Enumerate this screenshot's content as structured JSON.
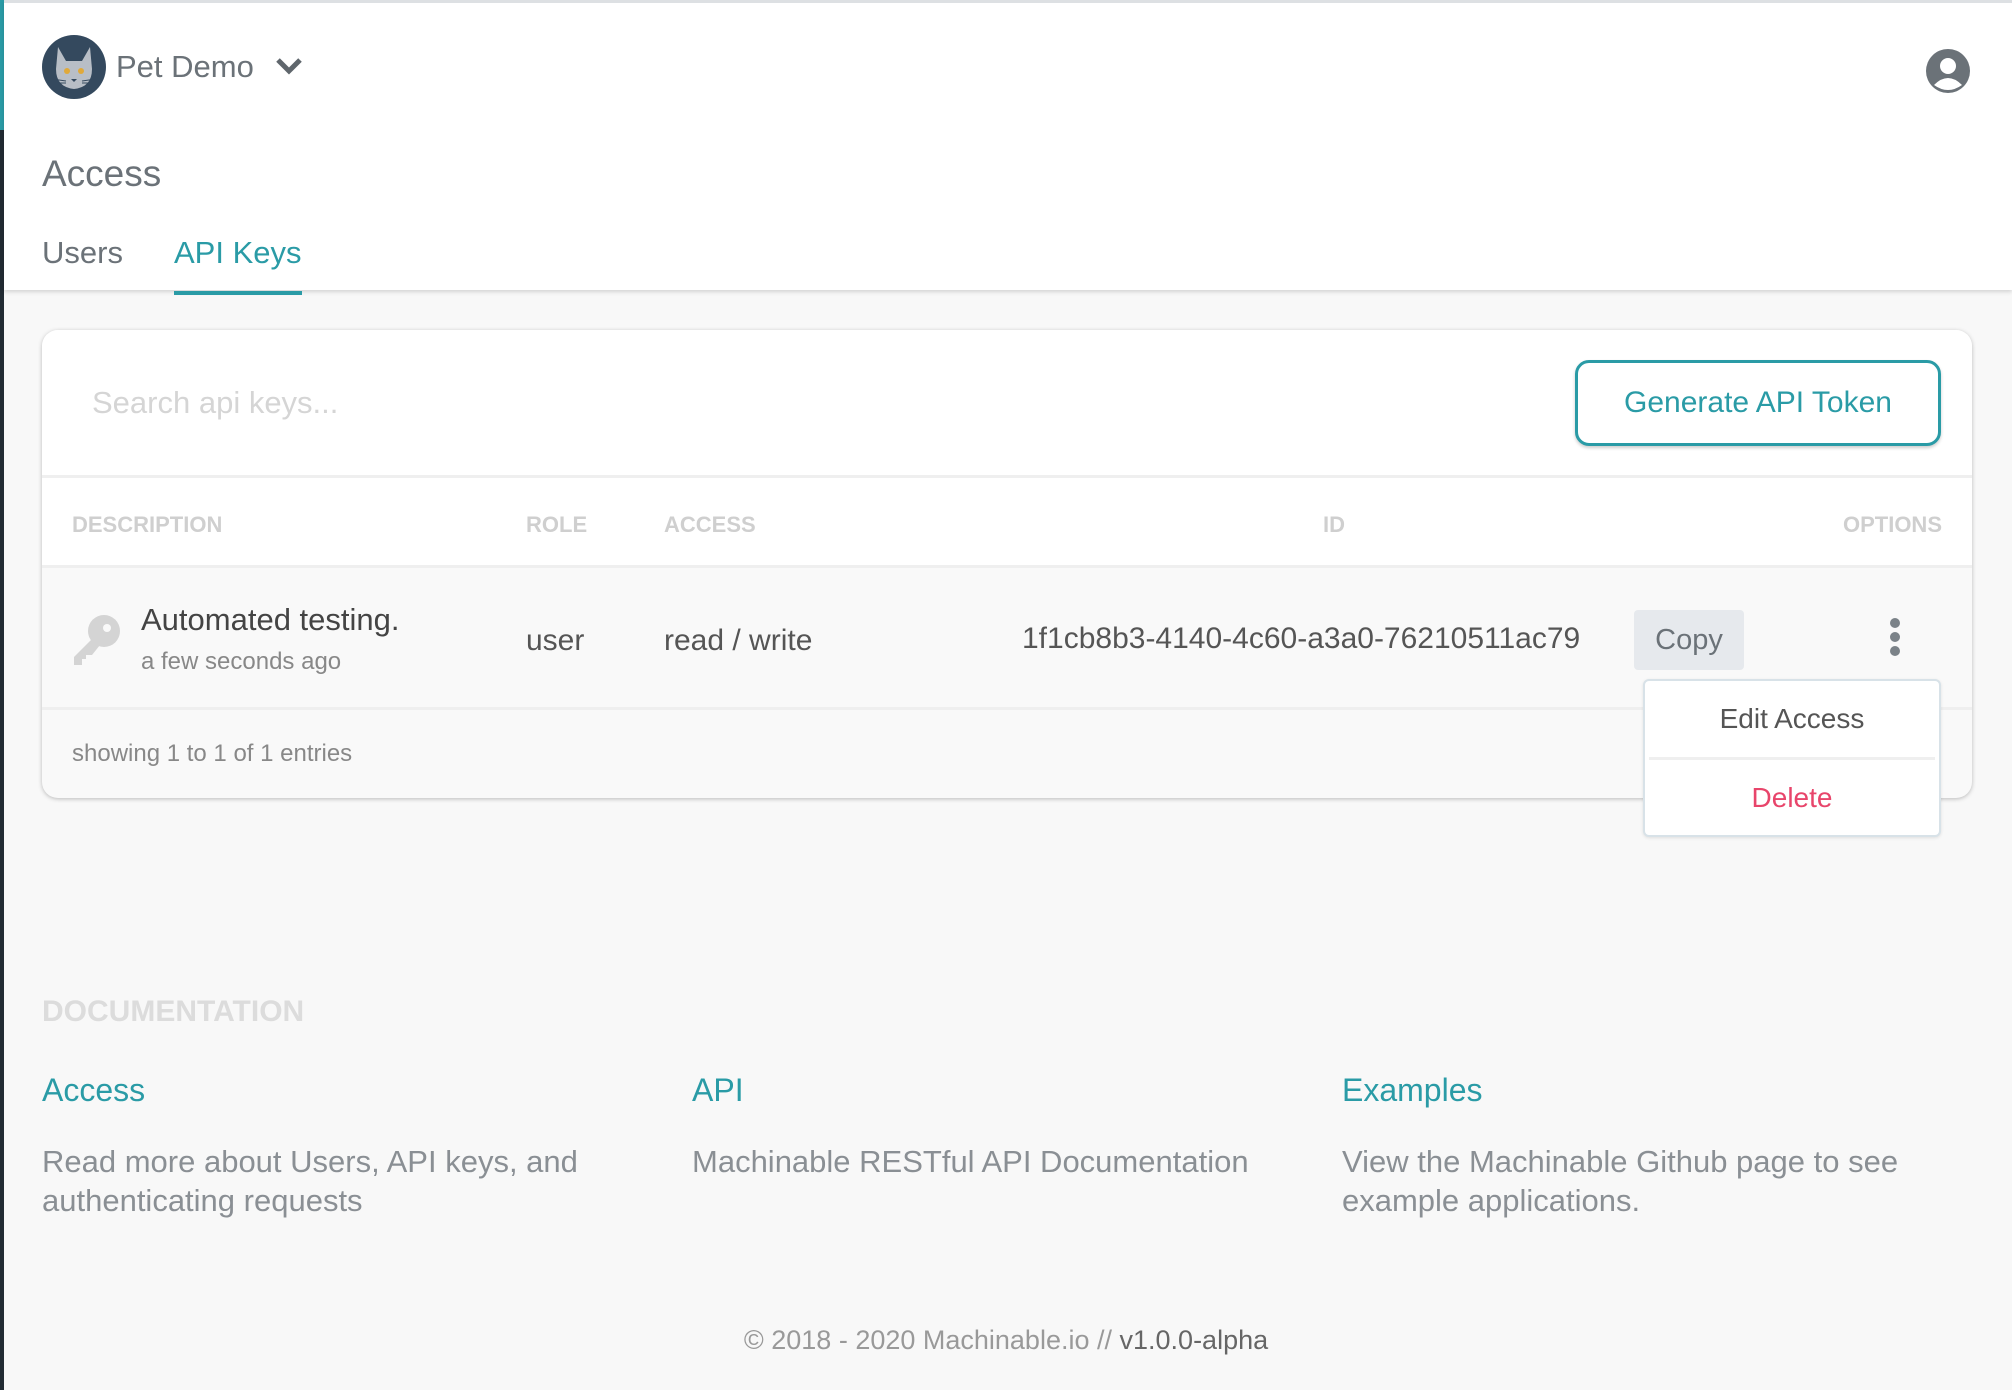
{
  "header": {
    "project_name": "Pet Demo",
    "page_title": "Access"
  },
  "tabs": [
    {
      "label": "Users",
      "active": false
    },
    {
      "label": "API Keys",
      "active": true
    }
  ],
  "search": {
    "placeholder": "Search api keys...",
    "value": ""
  },
  "generate_button": "Generate API Token",
  "table": {
    "columns": [
      "DESCRIPTION",
      "ROLE",
      "ACCESS",
      "ID",
      "OPTIONS"
    ],
    "rows": [
      {
        "description": "Automated testing.",
        "created": "a few seconds ago",
        "role": "user",
        "access": "read / write",
        "id": "1f1cb8b3-4140-4c60-a3a0-76210511ac79",
        "copy_label": "Copy"
      }
    ],
    "footer": "showing 1 to 1 of 1 entries"
  },
  "options_menu": {
    "edit": "Edit Access",
    "delete": "Delete"
  },
  "documentation": {
    "heading": "DOCUMENTATION",
    "items": [
      {
        "title": "Access",
        "text": "Read more about Users, API keys, and authenticating requests"
      },
      {
        "title": "API",
        "text": "Machinable RESTful API Documentation"
      },
      {
        "title": "Examples",
        "text": "View the Machinable Github page to see example applications."
      }
    ]
  },
  "footer": {
    "copyright": "© 2018 - 2020 Machinable.io //",
    "version": "v1.0.0-alpha"
  },
  "colors": {
    "accent": "#2a9ba6",
    "danger": "#e8456b"
  }
}
